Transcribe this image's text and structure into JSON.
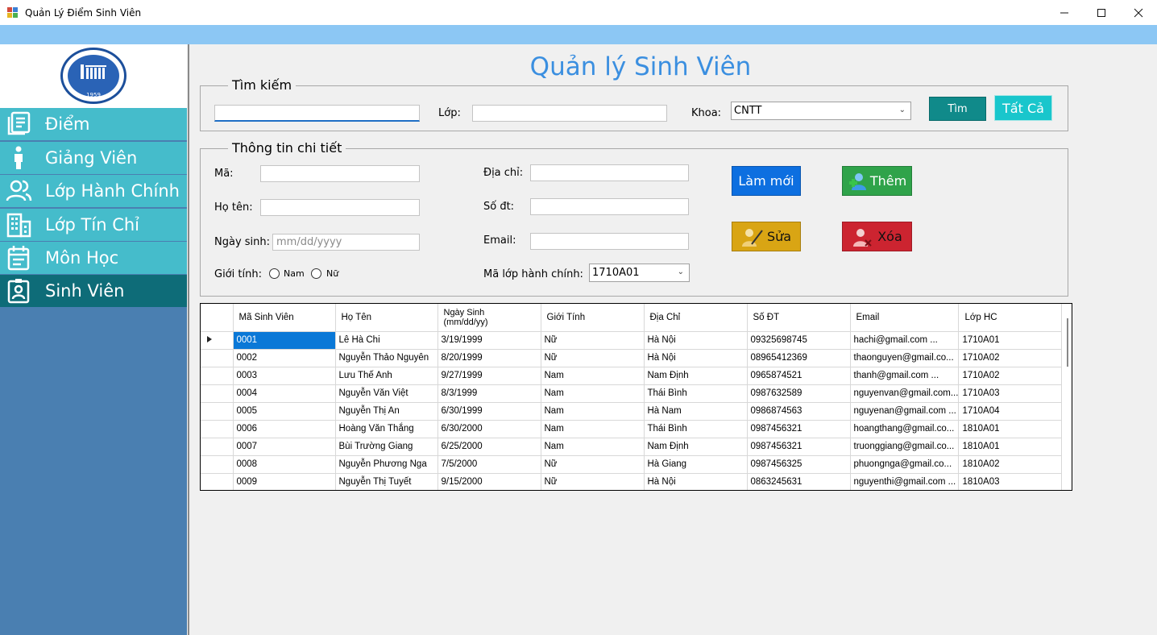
{
  "window": {
    "title": "Quản Lý Điểm Sinh Viên",
    "minimize": "—",
    "maximize": "☐",
    "close": "✕"
  },
  "logo": {
    "year": "1959"
  },
  "sidebar": {
    "items": [
      {
        "label": "Điểm",
        "icon": "document-icon"
      },
      {
        "label": "Giảng Viên",
        "icon": "person-icon"
      },
      {
        "label": "Lớp Hành Chính",
        "icon": "group-icon"
      },
      {
        "label": "Lớp Tín Chỉ",
        "icon": "building-icon"
      },
      {
        "label": "Môn Học",
        "icon": "calendar-icon"
      },
      {
        "label": "Sinh Viên",
        "icon": "id-card-icon"
      }
    ]
  },
  "main": {
    "title": "Quản lý Sinh Viên",
    "search": {
      "legend": "Tìm kiếm",
      "keyword_value": "",
      "class_label": "Lớp:",
      "class_value": "",
      "faculty_label": "Khoa:",
      "faculty_value": "CNTT",
      "search_button": "Tìm",
      "all_button": "Tất Cả"
    },
    "details": {
      "legend": "Thông tin chi tiết",
      "id_label": "Mã:",
      "name_label": "Họ tên:",
      "dob_label": "Ngày sinh:",
      "dob_placeholder": "mm/dd/yyyy",
      "gender_label": "Giới tính:",
      "male_label": "Nam",
      "female_label": "Nữ",
      "address_label": "Địa chỉ:",
      "phone_label": "Số đt:",
      "email_label": "Email:",
      "class_code_label": "Mã lớp hành chính:",
      "class_code_value": "1710A01",
      "refresh_button": "Làm mới",
      "add_button": "Thêm",
      "edit_button": "Sửa",
      "delete_button": "Xóa"
    },
    "grid": {
      "columns": [
        "Mã Sinh Viên",
        "Họ Tên",
        "Ngày Sinh\n(mm/dd/yy)",
        "Giới Tính",
        "Địa Chỉ",
        "Số ĐT",
        "Email",
        "Lớp HC"
      ],
      "rows": [
        [
          "0001",
          "Lê Hà Chi",
          "3/19/1999",
          "Nữ",
          "Hà Nội",
          "09325698745",
          "hachi@gmail.com        ...",
          "1710A01"
        ],
        [
          "0002",
          "Nguyễn Thảo Nguyên",
          "8/20/1999",
          "Nữ",
          "Hà Nội",
          "08965412369",
          "thaonguyen@gmail.co...",
          "1710A02"
        ],
        [
          "0003",
          "Lưu Thế Anh",
          "9/27/1999",
          "Nam",
          "Nam Định",
          "0965874521",
          "thanh@gmail.com        ...",
          "1710A02"
        ],
        [
          "0004",
          "Nguyễn Văn Việt",
          "8/3/1999",
          "Nam",
          "Thái Bình",
          "0987632589",
          "nguyenvan@gmail.com...",
          "1710A03"
        ],
        [
          "0005",
          "Nguyễn Thị An",
          "6/30/1999",
          "Nam",
          "Hà Nam",
          "0986874563",
          "nguyenan@gmail.com   ...",
          "1710A04"
        ],
        [
          "0006",
          "Hoàng Văn Thắng",
          "6/30/2000",
          "Nam",
          "Thái Bình",
          "0987456321",
          "hoangthang@gmail.co...",
          "1810A01"
        ],
        [
          "0007",
          "Bùi Trường Giang",
          "6/25/2000",
          "Nam",
          "Nam Định",
          "0987456321",
          "truonggiang@gmail.co...",
          "1810A01"
        ],
        [
          "0008",
          "Nguyễn Phương Nga",
          "7/5/2000",
          "Nữ",
          "Hà Giang",
          "0987456325",
          "phuongnga@gmail.co...",
          "1810A02"
        ],
        [
          "0009",
          "Nguyễn Thị Tuyết",
          "9/15/2000",
          "Nữ",
          "Hà Nội",
          "0863245631",
          "nguyenthi@gmail.com   ...",
          "1810A03"
        ]
      ]
    }
  },
  "colors": {
    "sidebar_bg": "#4a7fb1",
    "nav_item": "#45bccb",
    "nav_active": "#0e6c78",
    "title": "#3b8fe0",
    "search_btn": "#108a8a",
    "all_btn": "#19c6cc",
    "refresh_btn": "#0d6fe0",
    "add_btn": "#2fa34a",
    "edit_btn": "#d9a514",
    "delete_btn": "#cc2430",
    "selection": "#0a78d7"
  }
}
